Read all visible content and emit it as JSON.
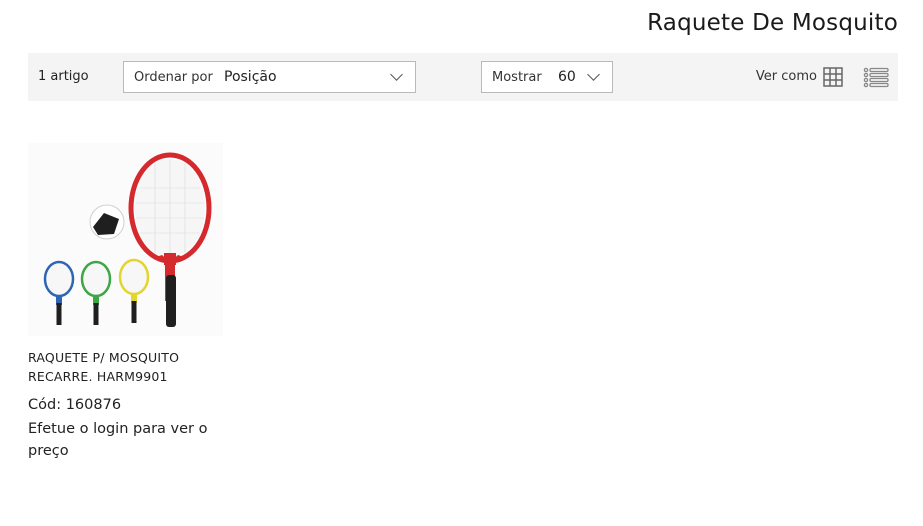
{
  "page": {
    "title": "Raquete De Mosquito"
  },
  "toolbar": {
    "amount": "1 artigo",
    "sorter": {
      "label": "Ordenar por",
      "value": "Posição"
    },
    "limiter": {
      "label": "Mostrar",
      "value": "60"
    },
    "view_mode": {
      "label": "Ver como",
      "modes": [
        "grid-icon",
        "list-icon"
      ]
    }
  },
  "products": [
    {
      "name": "RAQUETE P/ MOSQUITO RECARRE. HARM9901",
      "code": "Cód: 160876",
      "price_notice": "Efetue o login para ver o preço",
      "image_colors": {
        "main": "#d4292d",
        "blue": "#2f66b4",
        "green": "#3fa646",
        "yellow": "#e2d52e",
        "handle": "#1f1f1f"
      }
    }
  ]
}
